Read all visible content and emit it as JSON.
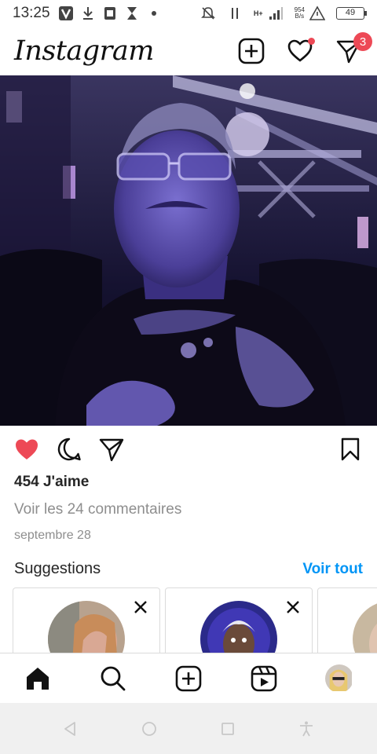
{
  "status_bar": {
    "time": "13:25",
    "network": "H+",
    "net_speed_value": "954",
    "net_speed_unit": "B/s",
    "battery": "49"
  },
  "header": {
    "logo": "Instagram",
    "messages_badge": "3",
    "icons": [
      "new-post-icon",
      "heart-icon",
      "direct-message-icon"
    ]
  },
  "post": {
    "likes": "454 J'aime",
    "comments_link": "Voir les 24 commentaires",
    "date": "septembre 28",
    "liked": true,
    "like_color": "#ed4956"
  },
  "suggestions": {
    "title": "Suggestions",
    "see_all": "Voir tout",
    "link_color": "#0095f6"
  },
  "bottom_nav": {
    "items": [
      "home-icon",
      "search-icon",
      "create-icon",
      "reels-icon",
      "profile-avatar"
    ]
  },
  "system_nav": {
    "items": [
      "back-icon",
      "home-circle-icon",
      "recents-icon",
      "accessibility-icon"
    ]
  }
}
